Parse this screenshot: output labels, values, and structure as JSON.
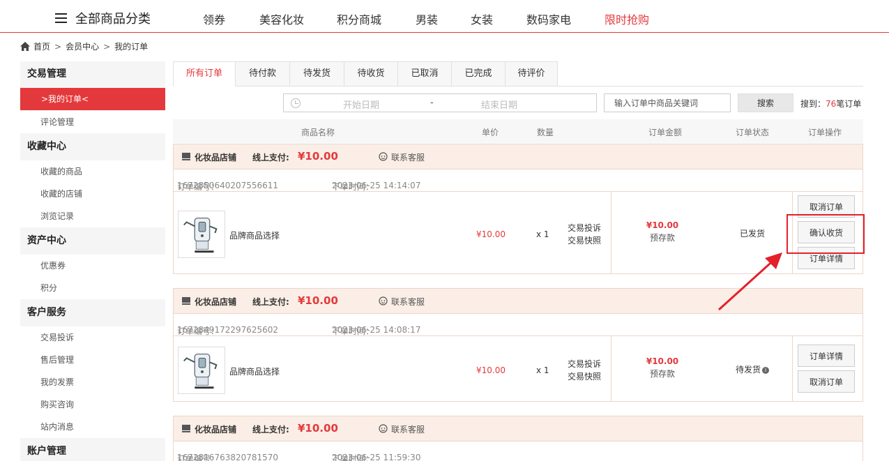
{
  "topnav": {
    "all_categories": "全部商品分类",
    "links": [
      "领券",
      "美容化妆",
      "积分商城",
      "男装",
      "女装",
      "数码家电",
      "限时抢购"
    ],
    "highlight_color": "#e4393c"
  },
  "breadcrumb": {
    "items": [
      "首页",
      "会员中心",
      "我的订单"
    ],
    "separator": ">"
  },
  "sidebar": {
    "groups": [
      {
        "title": "交易管理",
        "items": [
          ">我的订单<",
          "评论管理"
        ]
      },
      {
        "title": "收藏中心",
        "items": [
          "收藏的商品",
          "收藏的店铺",
          "浏览记录"
        ]
      },
      {
        "title": "资产中心",
        "items": [
          "优惠券",
          "积分"
        ]
      },
      {
        "title": "客户服务",
        "items": [
          "交易投诉",
          "售后管理",
          "我的发票",
          "购买咨询",
          "站内消息"
        ]
      },
      {
        "title": "账户管理",
        "items": []
      }
    ]
  },
  "tabs": [
    "所有订单",
    "待付款",
    "待发货",
    "待收货",
    "已取消",
    "已完成",
    "待评价"
  ],
  "filter": {
    "start_placeholder": "开始日期",
    "separator": "-",
    "end_placeholder": "结束日期",
    "keyword_placeholder": "输入订单中商品关键词",
    "search_label": "搜索",
    "result_prefix": "搜到：",
    "result_count": "76",
    "result_suffix": "笔订单"
  },
  "columns": [
    "商品名称",
    "单价",
    "数量",
    "订单金额",
    "订单状态",
    "订单操作"
  ],
  "labels": {
    "pay_label": "线上支付:",
    "contact": "联系客服",
    "order_no_label": "订单编号：",
    "order_time_label": "下单时间：",
    "service_1": "交易投诉",
    "service_2": "交易快照",
    "pay_type": "预存款"
  },
  "orders": [
    {
      "shop": "化妆品店铺",
      "paid": "¥10.00",
      "order_no": "1672850640207556611",
      "order_time": "2023-06-25 14:14:07",
      "product": "品牌商品选择",
      "unit_price": "¥10.00",
      "qty": "x 1",
      "amount": "¥10.00",
      "status": "已发货",
      "actions": [
        "取消订单",
        "确认收货",
        "订单详情"
      ]
    },
    {
      "shop": "化妆品店铺",
      "paid": "¥10.00",
      "order_no": "1672849172297625602",
      "order_time": "2023-06-25 14:08:17",
      "product": "品牌商品选择",
      "unit_price": "¥10.00",
      "qty": "x 1",
      "amount": "¥10.00",
      "status": "待发货",
      "actions": [
        "订单详情",
        "取消订单"
      ]
    },
    {
      "shop": "化妆品店铺",
      "paid": "¥10.00",
      "order_no": "1672816763820781570",
      "order_time": "2023-06-25 11:59:30"
    }
  ],
  "annotation": {
    "color": "#e4202a",
    "arrow_icon": "arrow-pointer-icon"
  }
}
